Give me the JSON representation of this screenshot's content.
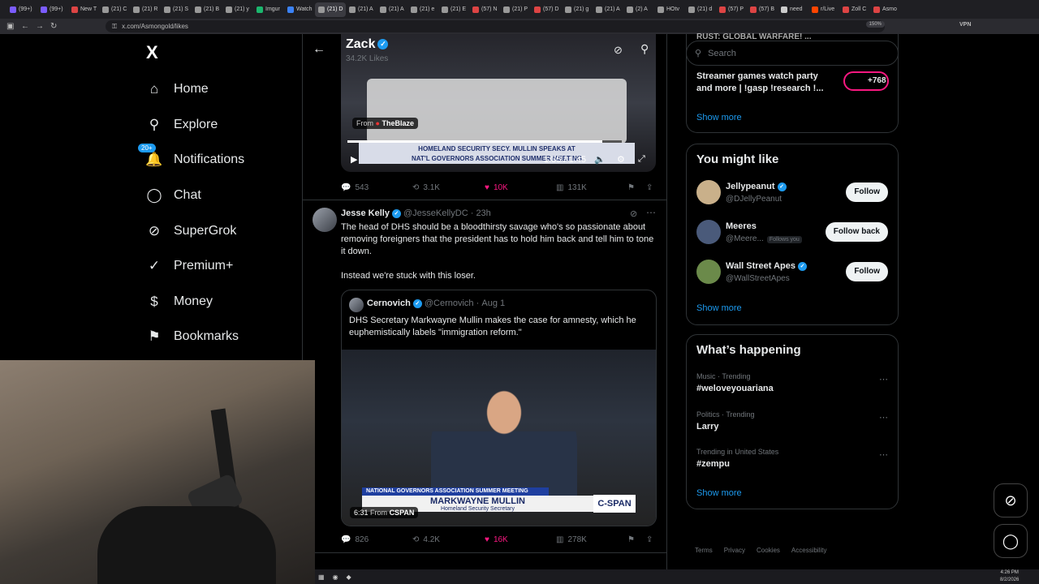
{
  "browser": {
    "tabs": [
      {
        "label": "(99+)",
        "color": "#7b5cff"
      },
      {
        "label": "(99+)",
        "color": "#7b5cff"
      },
      {
        "label": "New T",
        "color": "#d44"
      },
      {
        "label": "(21) C",
        "color": "#999"
      },
      {
        "label": "(21) R",
        "color": "#999"
      },
      {
        "label": "(21) S",
        "color": "#999"
      },
      {
        "label": "(21) B",
        "color": "#999"
      },
      {
        "label": "(21) y",
        "color": "#999"
      },
      {
        "label": "Imgur",
        "color": "#1bb76e"
      },
      {
        "label": "Watch",
        "color": "#3b82f6"
      },
      {
        "label": "(21) D",
        "color": "#999",
        "active": true
      },
      {
        "label": "(21) A",
        "color": "#999"
      },
      {
        "label": "(21) A",
        "color": "#999"
      },
      {
        "label": "(21) e",
        "color": "#999"
      },
      {
        "label": "(21) E",
        "color": "#999"
      },
      {
        "label": "(57) N",
        "color": "#d44"
      },
      {
        "label": "(21) P",
        "color": "#999"
      },
      {
        "label": "(57) D",
        "color": "#d44"
      },
      {
        "label": "(21) g",
        "color": "#999"
      },
      {
        "label": "(21) A",
        "color": "#999"
      },
      {
        "label": "(2) A",
        "color": "#999"
      },
      {
        "label": "HOtv",
        "color": "#999"
      },
      {
        "label": "(21) d",
        "color": "#999"
      },
      {
        "label": "(57) P",
        "color": "#d44"
      },
      {
        "label": "(57) B",
        "color": "#d44"
      },
      {
        "label": "need",
        "color": "#ccc"
      },
      {
        "label": "r/Live",
        "color": "#ff4500"
      },
      {
        "label": "Zoll C",
        "color": "#d44"
      },
      {
        "label": "Asmo",
        "color": "#d44"
      }
    ],
    "url": "x.com/Asmongold/likes",
    "zoom": "150%",
    "vpn": "VPN"
  },
  "sidebar": {
    "logo": "X",
    "notifications_badge": "20+",
    "items": [
      {
        "label": "Home",
        "icon": "⌂"
      },
      {
        "label": "Explore",
        "icon": "⚲"
      },
      {
        "label": "Notifications",
        "icon": "🔔"
      },
      {
        "label": "Chat",
        "icon": "◯"
      },
      {
        "label": "SuperGrok",
        "icon": "⊘"
      },
      {
        "label": "Premium+",
        "icon": "✓"
      },
      {
        "label": "Money",
        "icon": "$"
      },
      {
        "label": "Bookmarks",
        "icon": "⚑"
      }
    ]
  },
  "header": {
    "title": "Zack",
    "subtitle": "34.2K Likes"
  },
  "post1": {
    "from_label": "From",
    "from_source": "TheBlaze",
    "chyron_line1": "HOMELAND SECURITY SECY. MULLIN SPEAKS AT",
    "chyron_line2": "NAT'L GOVERNORS ASSOCIATION SUMMER MEETING",
    "time": "1:35 / 1:45",
    "progress": 0.93,
    "replies": "543",
    "reposts": "3.1K",
    "likes": "10K",
    "views": "131K"
  },
  "post2": {
    "name": "Jesse Kelly",
    "handle": "@JesseKellyDC",
    "time": "23h",
    "text1": "The head of DHS should be a bloodthirsty savage who's so passionate about removing foreigners that the president has to hold him back and tell him to tone it down.",
    "text2": "Instead we're stuck with this loser.",
    "quote": {
      "name": "Cernovich",
      "handle": "@Cernovich",
      "date": "Aug 1",
      "text": "DHS Secretary Markwayne Mullin makes the case for  amnesty, which he euphemistically labels \"immigration reform.\"",
      "chyron_top": "NATIONAL GOVERNORS ASSOCIATION SUMMER MEETING",
      "chyron_name": "MARKWAYNE MULLIN",
      "chyron_title": "Homeland Security Secretary",
      "cspan": "C-SPAN",
      "duration": "6:31",
      "from_label": "From",
      "from_source": "CSPAN"
    },
    "replies": "826",
    "reposts": "4.2K",
    "likes": "16K",
    "views": "278K"
  },
  "right": {
    "search_placeholder": "Search",
    "top_card": {
      "header": "RUST: GLOBAL WARFARE! ...",
      "title": "Streamer games watch party and more | !gasp !research !...",
      "count": "+768",
      "show_more": "Show more"
    },
    "might_like": {
      "title": "You might like",
      "users": [
        {
          "name": "Jellypeanut",
          "handle": "@DJellyPeanut",
          "button": "Follow",
          "verified": true
        },
        {
          "name": "Meeres",
          "handle": "@Meere...",
          "follows_you": "Follows you",
          "button": "Follow back",
          "verified": false
        },
        {
          "name": "Wall Street Apes",
          "handle": "@WallStreetApes",
          "button": "Follow",
          "verified": true
        }
      ],
      "show_more": "Show more"
    },
    "happening": {
      "title": "What’s happening",
      "trends": [
        {
          "category": "Music · Trending",
          "name": "#weloveyouariana"
        },
        {
          "category": "Politics · Trending",
          "name": "Larry"
        },
        {
          "category": "Trending in United States",
          "name": "#zempu"
        }
      ],
      "show_more": "Show more"
    },
    "footer": [
      "Terms",
      "Privacy",
      "Cookies",
      "Accessibility"
    ]
  },
  "taskbar": {
    "time": "4:26 PM",
    "date": "8/2/2026"
  }
}
